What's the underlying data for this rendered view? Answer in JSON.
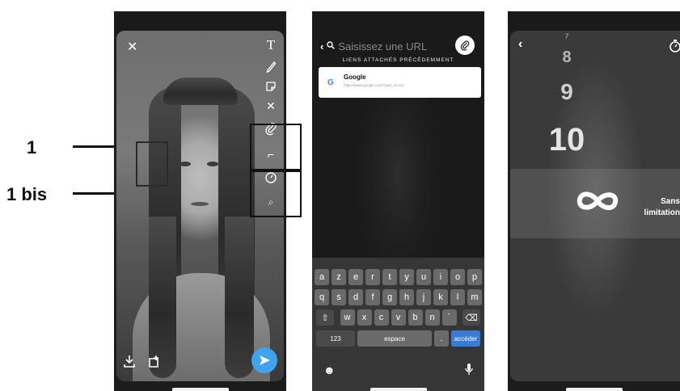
{
  "annotations": {
    "label_1": "1",
    "label_1bis": "1 bis"
  },
  "phone1": {
    "close_icon": "close-icon",
    "tools": [
      "text-icon",
      "pencil-icon",
      "sticker-icon",
      "scissors-icon",
      "paperclip-icon",
      "crop-icon",
      "timer-icon",
      "camera-icon"
    ],
    "text_tool": "T",
    "scissors_tool": "✕",
    "bottom_icons": [
      "download-icon",
      "add-story-icon"
    ],
    "send_color": "#3fa3ee"
  },
  "phone2": {
    "url_placeholder": "Saisissez une URL",
    "section_title": "LIENS ATTACHÉS PRÉCÉDEMMENT",
    "link": {
      "title": "Google",
      "url": "https://www.google.com/?gws_rd=ssl",
      "logo": "G"
    },
    "keyboard": {
      "row1": [
        "a",
        "z",
        "e",
        "r",
        "t",
        "y",
        "u",
        "i",
        "o",
        "p"
      ],
      "row2": [
        "q",
        "s",
        "d",
        "f",
        "g",
        "h",
        "j",
        "k",
        "l",
        "m"
      ],
      "row3": [
        "w",
        "x",
        "c",
        "v",
        "b",
        "n",
        "´"
      ],
      "numbers_key": "123",
      "space_key": "espace",
      "period_key": ".",
      "go_key": "accéder",
      "go_color": "#3a7bd5"
    }
  },
  "phone3": {
    "numbers": [
      "7",
      "8",
      "9",
      "10"
    ],
    "selected_label_line1": "Sans",
    "selected_label_line2": "limitation"
  }
}
